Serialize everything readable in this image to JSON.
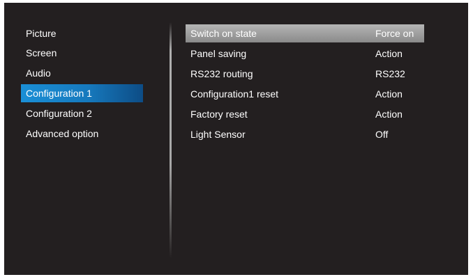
{
  "left_menu": {
    "items": [
      {
        "label": "Picture"
      },
      {
        "label": "Screen"
      },
      {
        "label": "Audio"
      },
      {
        "label": "Configuration 1",
        "selected": true
      },
      {
        "label": "Configuration 2"
      },
      {
        "label": "Advanced option"
      }
    ]
  },
  "settings": {
    "rows": [
      {
        "label": "Switch on state",
        "value": "Force on",
        "selected": true
      },
      {
        "label": "Panel saving",
        "value": "Action"
      },
      {
        "label": "RS232 routing",
        "value": "RS232"
      },
      {
        "label": "Configuration1 reset",
        "value": "Action"
      },
      {
        "label": "Factory reset",
        "value": "Action"
      },
      {
        "label": "Light Sensor",
        "value": "Off"
      }
    ]
  },
  "colors": {
    "background": "#231f20",
    "left_selection": "#1679bd",
    "right_selection": "#a0a0a0",
    "text": "#ffffff"
  }
}
